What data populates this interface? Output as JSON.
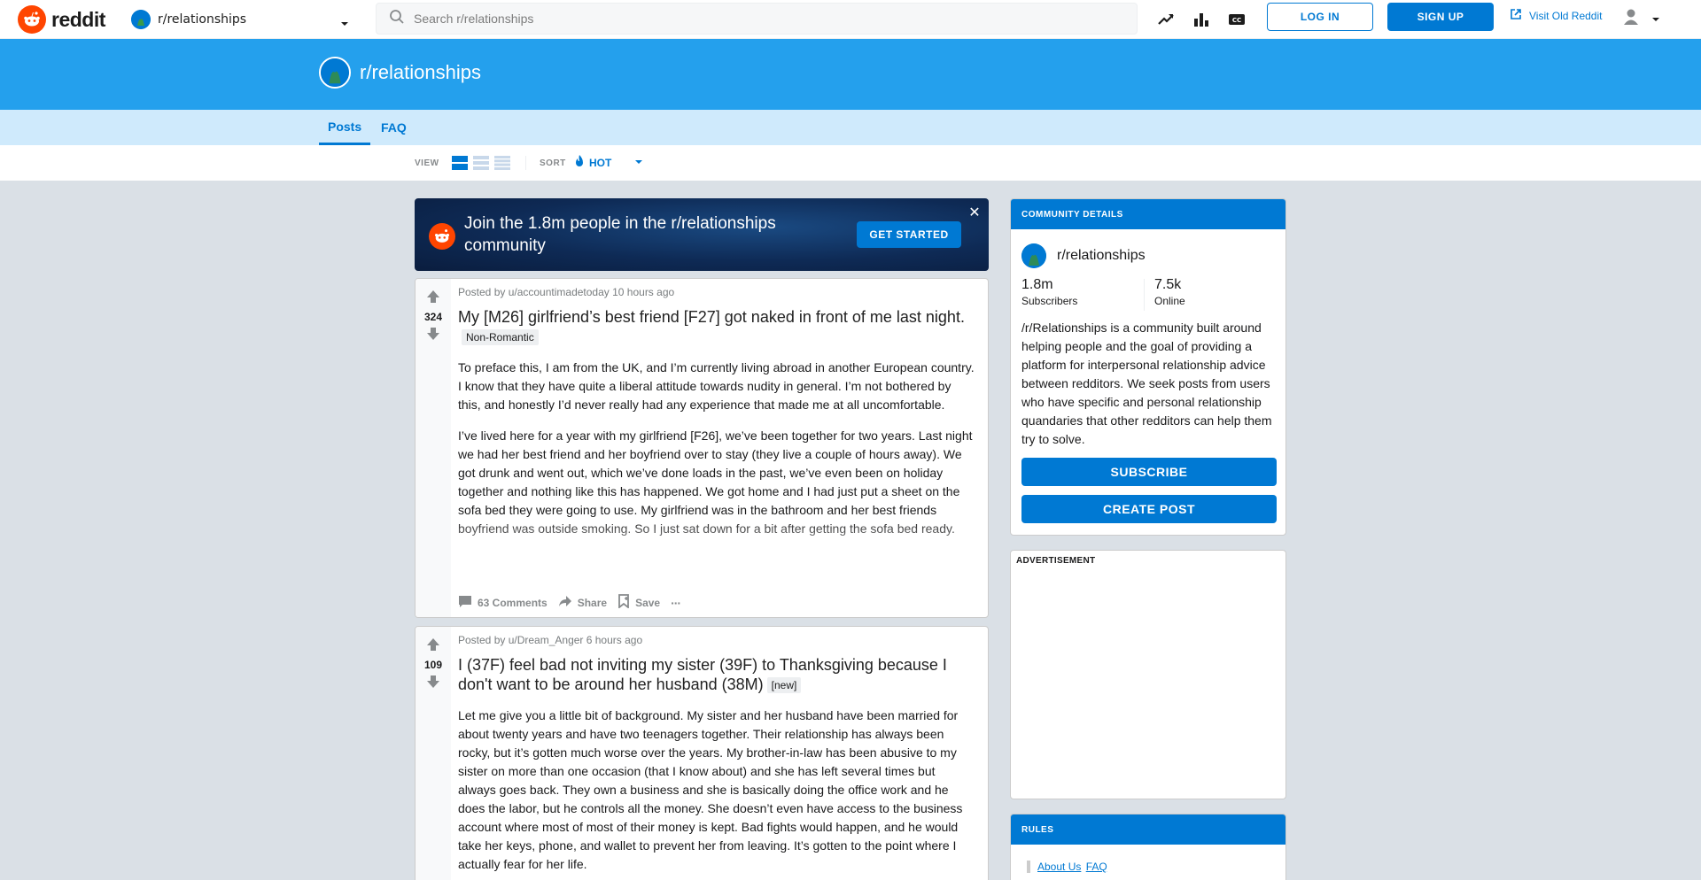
{
  "header": {
    "logo_text": "reddit",
    "community": "r/relationships",
    "search_placeholder": "Search r/relationships",
    "login": "LOG IN",
    "signup": "SIGN UP",
    "old_reddit": "Visit Old Reddit",
    "icons": [
      "trending-icon",
      "stats-icon",
      "cc-icon",
      "external-link-icon",
      "user-icon",
      "chevron-down-icon"
    ]
  },
  "banner": {
    "title": "r/relationships",
    "color": "#24a0ed"
  },
  "tabs": [
    {
      "label": "Posts",
      "active": true
    },
    {
      "label": "FAQ",
      "active": false
    }
  ],
  "sortbar": {
    "view_label": "VIEW",
    "sort_label": "SORT",
    "sort_value": "HOT"
  },
  "join_card": {
    "text": "Join the 1.8m people in the r/relationships community",
    "button": "GET STARTED",
    "close": "✕"
  },
  "posts": [
    {
      "score": "324",
      "meta": "Posted by u/accountimadetoday 10 hours ago",
      "title": "My [M26] girlfriend’s best friend [F27] got naked in front of me last night.",
      "flair": "Non-Romantic",
      "paragraphs": [
        "To preface this, I am from the UK, and I’m currently living abroad in another European country. I know that they have quite a liberal attitude towards nudity in general. I’m not bothered by this, and honestly I’d never really had any experience that made me at all uncomfortable.",
        "I’ve lived here for a year with my girlfriend [F26], we’ve been together for two years. Last night we had her best friend and her boyfriend over to stay (they live a couple of hours away). We got drunk and went out, which we’ve done loads in the past, we’ve even been on holiday together and nothing like this has happened. We got home and I had just put a sheet on the sofa bed they were going to use. My girlfriend was in the bathroom and her best friends boyfriend was outside smoking. So I just sat down for a bit after getting the sofa bed ready."
      ],
      "comments": "63 Comments",
      "share": "Share",
      "save": "Save",
      "more": "···"
    },
    {
      "score": "109",
      "meta": "Posted by u/Dream_Anger 6 hours ago",
      "title": "I (37F) feel bad not inviting my sister (39F) to Thanksgiving because I don't want to be around her husband (38M)",
      "flair": "[new]",
      "paragraphs": [
        "Let me give you a little bit of background. My sister and her husband have been married for about twenty years and have two teenagers together. Their relationship has always been rocky, but it’s gotten much worse over the years. My brother-in-law has been abusive to my sister on more than one occasion (that I know about) and she has left several times but always goes back. They own a business and she is basically doing the office work and he does the labor, but he controls all the money. She doesn’t even have access to the business account where most of most of their money is kept. Bad fights would happen, and he would take her keys, phone, and wallet to prevent her from leaving. It’s gotten to the point where I actually fear for her life."
      ]
    }
  ],
  "sidebar": {
    "community_details": {
      "header": "COMMUNITY DETAILS",
      "name": "r/relationships",
      "subscribers": "1.8m",
      "subscribers_label": "Subscribers",
      "online": "7.5k",
      "online_label": "Online",
      "description": "/r/Relationships is a community built around helping people and the goal of providing a platform for interpersonal relationship advice between redditors. We seek posts from users who have specific and personal relationship quandaries that other redditors can help them try to solve.",
      "subscribe": "SUBSCRIBE",
      "create_post": "CREATE POST"
    },
    "ad_label": "ADVERTISEMENT",
    "rules": {
      "header": "RULES",
      "link1": "About Us",
      "link2": "FAQ"
    }
  },
  "colors": {
    "brand_orange": "#ff4500",
    "accent_blue": "#0079d3",
    "tab_bar": "#cfeafc",
    "page_bg": "#dae0e6"
  }
}
